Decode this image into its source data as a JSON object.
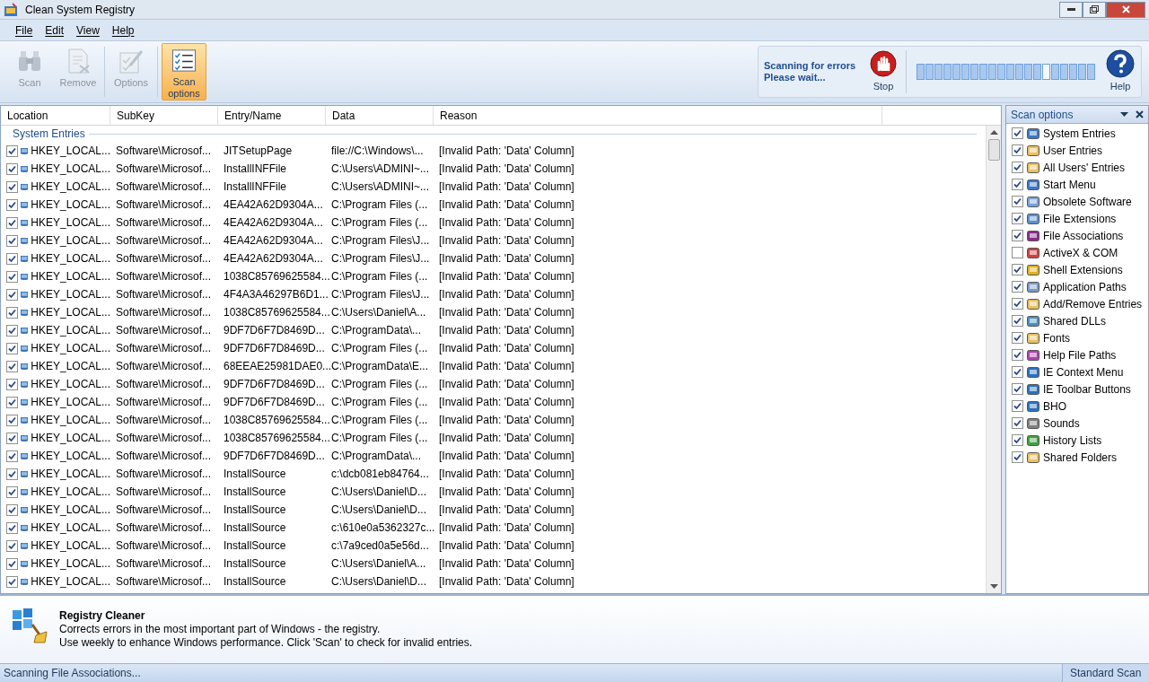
{
  "window": {
    "title": "Clean System Registry"
  },
  "menu": [
    "File",
    "Edit",
    "View",
    "Help"
  ],
  "toolbar": [
    {
      "label": "Scan",
      "disabled": true,
      "selected": false,
      "kind": "scan"
    },
    {
      "label": "Remove",
      "disabled": true,
      "selected": false,
      "kind": "remove"
    },
    {
      "label": "Options",
      "disabled": true,
      "selected": false,
      "kind": "options"
    },
    {
      "label": "Scan options",
      "disabled": false,
      "selected": true,
      "kind": "scanopts"
    }
  ],
  "scan_status": {
    "lines": [
      "Scanning for errors",
      "Please wait..."
    ],
    "stop": "Stop",
    "help": "Help"
  },
  "table": {
    "columns": [
      "Location",
      "SubKey",
      "Entry/Name",
      "Data",
      "Reason"
    ],
    "group": "System Entries",
    "rows": [
      {
        "checked": true,
        "cells": [
          "HKEY_LOCAL...",
          "Software\\Microsof...",
          "JITSetupPage",
          "file://C:\\Windows\\...",
          "[Invalid Path: 'Data' Column]"
        ]
      },
      {
        "checked": true,
        "cells": [
          "HKEY_LOCAL...",
          "Software\\Microsof...",
          "InstallINFFile",
          "C:\\Users\\ADMINI~...",
          "[Invalid Path: 'Data' Column]"
        ]
      },
      {
        "checked": true,
        "cells": [
          "HKEY_LOCAL...",
          "Software\\Microsof...",
          "InstallINFFile",
          "C:\\Users\\ADMINI~...",
          "[Invalid Path: 'Data' Column]"
        ]
      },
      {
        "checked": true,
        "cells": [
          "HKEY_LOCAL...",
          "Software\\Microsof...",
          "4EA42A62D9304A...",
          "C:\\Program Files (...",
          "[Invalid Path: 'Data' Column]"
        ]
      },
      {
        "checked": true,
        "cells": [
          "HKEY_LOCAL...",
          "Software\\Microsof...",
          "4EA42A62D9304A...",
          "C:\\Program Files (...",
          "[Invalid Path: 'Data' Column]"
        ]
      },
      {
        "checked": true,
        "cells": [
          "HKEY_LOCAL...",
          "Software\\Microsof...",
          "4EA42A62D9304A...",
          "C:\\Program Files\\J...",
          "[Invalid Path: 'Data' Column]"
        ]
      },
      {
        "checked": true,
        "cells": [
          "HKEY_LOCAL...",
          "Software\\Microsof...",
          "4EA42A62D9304A...",
          "C:\\Program Files\\J...",
          "[Invalid Path: 'Data' Column]"
        ]
      },
      {
        "checked": true,
        "cells": [
          "HKEY_LOCAL...",
          "Software\\Microsof...",
          "1038C85769625584...",
          "C:\\Program Files (...",
          "[Invalid Path: 'Data' Column]"
        ]
      },
      {
        "checked": true,
        "cells": [
          "HKEY_LOCAL...",
          "Software\\Microsof...",
          "4F4A3A46297B6D1...",
          "C:\\Program Files\\J...",
          "[Invalid Path: 'Data' Column]"
        ]
      },
      {
        "checked": true,
        "cells": [
          "HKEY_LOCAL...",
          "Software\\Microsof...",
          "1038C85769625584...",
          "C:\\Users\\Daniel\\A...",
          "[Invalid Path: 'Data' Column]"
        ]
      },
      {
        "checked": true,
        "cells": [
          "HKEY_LOCAL...",
          "Software\\Microsof...",
          "9DF7D6F7D8469D...",
          "C:\\ProgramData\\...",
          "[Invalid Path: 'Data' Column]"
        ]
      },
      {
        "checked": true,
        "cells": [
          "HKEY_LOCAL...",
          "Software\\Microsof...",
          "9DF7D6F7D8469D...",
          "C:\\Program Files (...",
          "[Invalid Path: 'Data' Column]"
        ]
      },
      {
        "checked": true,
        "cells": [
          "HKEY_LOCAL...",
          "Software\\Microsof...",
          "68EEAE25981DAE0...",
          "C:\\ProgramData\\E...",
          "[Invalid Path: 'Data' Column]"
        ]
      },
      {
        "checked": true,
        "cells": [
          "HKEY_LOCAL...",
          "Software\\Microsof...",
          "9DF7D6F7D8469D...",
          "C:\\Program Files (...",
          "[Invalid Path: 'Data' Column]"
        ]
      },
      {
        "checked": true,
        "cells": [
          "HKEY_LOCAL...",
          "Software\\Microsof...",
          "9DF7D6F7D8469D...",
          "C:\\Program Files (...",
          "[Invalid Path: 'Data' Column]"
        ]
      },
      {
        "checked": true,
        "cells": [
          "HKEY_LOCAL...",
          "Software\\Microsof...",
          "1038C85769625584...",
          "C:\\Program Files (...",
          "[Invalid Path: 'Data' Column]"
        ]
      },
      {
        "checked": true,
        "cells": [
          "HKEY_LOCAL...",
          "Software\\Microsof...",
          "1038C85769625584...",
          "C:\\Program Files (...",
          "[Invalid Path: 'Data' Column]"
        ]
      },
      {
        "checked": true,
        "cells": [
          "HKEY_LOCAL...",
          "Software\\Microsof...",
          "9DF7D6F7D8469D...",
          "C:\\ProgramData\\...",
          "[Invalid Path: 'Data' Column]"
        ]
      },
      {
        "checked": true,
        "cells": [
          "HKEY_LOCAL...",
          "Software\\Microsof...",
          "InstallSource",
          "c:\\dcb081eb84764...",
          "[Invalid Path: 'Data' Column]"
        ]
      },
      {
        "checked": true,
        "cells": [
          "HKEY_LOCAL...",
          "Software\\Microsof...",
          "InstallSource",
          "C:\\Users\\Daniel\\D...",
          "[Invalid Path: 'Data' Column]"
        ]
      },
      {
        "checked": true,
        "cells": [
          "HKEY_LOCAL...",
          "Software\\Microsof...",
          "InstallSource",
          "C:\\Users\\Daniel\\D...",
          "[Invalid Path: 'Data' Column]"
        ]
      },
      {
        "checked": true,
        "cells": [
          "HKEY_LOCAL...",
          "Software\\Microsof...",
          "InstallSource",
          "c:\\610e0a5362327c...",
          "[Invalid Path: 'Data' Column]"
        ]
      },
      {
        "checked": true,
        "cells": [
          "HKEY_LOCAL...",
          "Software\\Microsof...",
          "InstallSource",
          "c:\\7a9ced0a5e56d...",
          "[Invalid Path: 'Data' Column]"
        ]
      },
      {
        "checked": true,
        "cells": [
          "HKEY_LOCAL...",
          "Software\\Microsof...",
          "InstallSource",
          "C:\\Users\\Daniel\\A...",
          "[Invalid Path: 'Data' Column]"
        ]
      },
      {
        "checked": true,
        "cells": [
          "HKEY_LOCAL...",
          "Software\\Microsof...",
          "InstallSource",
          "C:\\Users\\Daniel\\D...",
          "[Invalid Path: 'Data' Column]"
        ]
      }
    ]
  },
  "scan_options": {
    "title": "Scan options",
    "items": [
      {
        "label": "System Entries",
        "checked": true
      },
      {
        "label": "User Entries",
        "checked": true
      },
      {
        "label": "All Users' Entries",
        "checked": true
      },
      {
        "label": "Start Menu",
        "checked": true
      },
      {
        "label": "Obsolete Software",
        "checked": true
      },
      {
        "label": "File Extensions",
        "checked": true
      },
      {
        "label": "File Associations",
        "checked": true
      },
      {
        "label": "ActiveX & COM",
        "checked": false
      },
      {
        "label": "Shell Extensions",
        "checked": true
      },
      {
        "label": "Application Paths",
        "checked": true
      },
      {
        "label": "Add/Remove Entries",
        "checked": true
      },
      {
        "label": "Shared DLLs",
        "checked": true
      },
      {
        "label": "Fonts",
        "checked": true
      },
      {
        "label": "Help File Paths",
        "checked": true
      },
      {
        "label": "IE Context Menu",
        "checked": true
      },
      {
        "label": "IE Toolbar Buttons",
        "checked": true
      },
      {
        "label": "BHO",
        "checked": true
      },
      {
        "label": "Sounds",
        "checked": true
      },
      {
        "label": "History Lists",
        "checked": true
      },
      {
        "label": "Shared Folders",
        "checked": true
      }
    ]
  },
  "info": {
    "title": "Registry Cleaner",
    "lines": [
      "Corrects errors in the most important part of Windows - the registry.",
      "Use weekly to enhance Windows performance. Click 'Scan' to check for invalid entries."
    ]
  },
  "status_bar": {
    "message": "Scanning File Associations...",
    "mode": "Standard Scan"
  }
}
